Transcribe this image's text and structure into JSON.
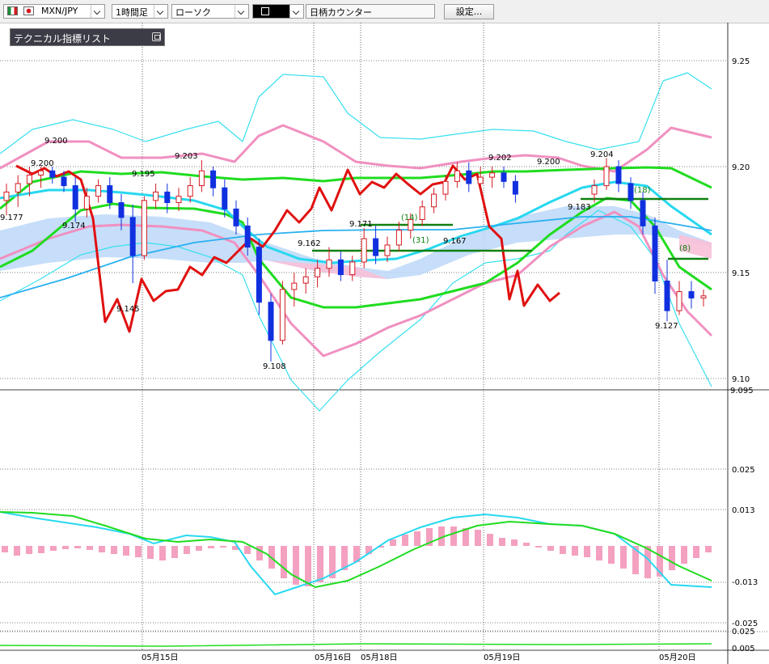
{
  "toolbar": {
    "pair_label": "MXN/JPY",
    "period_label": "1時間足",
    "chart_type_label": "ローソク",
    "counter_label": "日柄カウンター",
    "settings_label": "設定...",
    "flag_colors": [
      "#1a8f3a",
      "#ffffff",
      "#d41920"
    ],
    "jp_flag_colors": [
      "#ffffff",
      "#d41920"
    ]
  },
  "indicator_list": {
    "label": "テクニカル指標リスト"
  },
  "colors": {
    "bull_candle": "#d41920",
    "bear_candle": "#1030e0",
    "bollinger_outer": "#38e0f0",
    "bollinger_inner": "#f090c0",
    "ma_green": "#20dc20",
    "ma_cyan": "#28d8f0",
    "lagging_line": "#e01010",
    "cloud": "#bcd8f8",
    "cloud_alt": "#f8c0d8",
    "hline": "#108010",
    "long_ma": "#28b0f0",
    "macd_line": "#28d8f0",
    "macd_signal": "#20dc20",
    "macd_hist": "#f4a0c0"
  },
  "chart_data": {
    "type": "line",
    "symbol": "MXN/JPY",
    "price_axis": {
      "ticks": [
        "9.25",
        "9.20",
        "9.15",
        "9.10"
      ],
      "current_price_label": "9.095",
      "range": [
        9.095,
        9.25
      ]
    },
    "macd_axis": {
      "ticks": [
        "0.025",
        "0.013",
        "-0.013",
        "-0.025"
      ]
    },
    "sub_axis": {
      "ticks": [
        "0.025",
        "0.005"
      ]
    },
    "x_labels": [
      "05月15日",
      "05月16日",
      "05月18日",
      "05月19日",
      "05月20日"
    ],
    "price_annotations": [
      "9.177",
      "9.200",
      "9.200",
      "9.174",
      "9.195",
      "9.145",
      "9.203",
      "9.108",
      "9.162",
      "9.171",
      "9.167",
      "9.202",
      "9.200",
      "9.183",
      "9.204",
      "9.127"
    ],
    "count_annotations": [
      "(14)",
      "(31)",
      "(18)",
      "(8)"
    ],
    "candles": [
      [
        9.184,
        9.192,
        9.177,
        9.188
      ],
      [
        9.188,
        9.196,
        9.181,
        9.192
      ],
      [
        9.192,
        9.2,
        9.186,
        9.196
      ],
      [
        9.196,
        9.2,
        9.19,
        9.198
      ],
      [
        9.198,
        9.2,
        9.192,
        9.195
      ],
      [
        9.195,
        9.198,
        9.188,
        9.191
      ],
      [
        9.191,
        9.195,
        9.174,
        9.18
      ],
      [
        9.18,
        9.19,
        9.176,
        9.186
      ],
      [
        9.186,
        9.194,
        9.183,
        9.191
      ],
      [
        9.191,
        9.195,
        9.18,
        9.183
      ],
      [
        9.183,
        9.187,
        9.17,
        9.176
      ],
      [
        9.176,
        9.182,
        9.145,
        9.158
      ],
      [
        9.158,
        9.186,
        9.156,
        9.184
      ],
      [
        9.184,
        9.192,
        9.18,
        9.188
      ],
      [
        9.188,
        9.192,
        9.178,
        9.183
      ],
      [
        9.183,
        9.19,
        9.179,
        9.186
      ],
      [
        9.186,
        9.195,
        9.183,
        9.191
      ],
      [
        9.191,
        9.203,
        9.188,
        9.198
      ],
      [
        9.198,
        9.2,
        9.186,
        9.19
      ],
      [
        9.19,
        9.194,
        9.176,
        9.18
      ],
      [
        9.18,
        9.184,
        9.168,
        9.172
      ],
      [
        9.172,
        9.176,
        9.158,
        9.162
      ],
      [
        9.162,
        9.166,
        9.13,
        9.136
      ],
      [
        9.136,
        9.14,
        9.108,
        9.118
      ],
      [
        9.118,
        9.146,
        9.116,
        9.142
      ],
      [
        9.142,
        9.15,
        9.134,
        9.145
      ],
      [
        9.145,
        9.152,
        9.14,
        9.148
      ],
      [
        9.148,
        9.156,
        9.143,
        9.152
      ],
      [
        9.152,
        9.162,
        9.148,
        9.156
      ],
      [
        9.156,
        9.16,
        9.146,
        9.149
      ],
      [
        9.149,
        9.158,
        9.146,
        9.155
      ],
      [
        9.155,
        9.171,
        9.152,
        9.166
      ],
      [
        9.166,
        9.172,
        9.154,
        9.158
      ],
      [
        9.158,
        9.167,
        9.155,
        9.163
      ],
      [
        9.163,
        9.174,
        9.16,
        9.17
      ],
      [
        9.17,
        9.178,
        9.166,
        9.175
      ],
      [
        9.175,
        9.184,
        9.172,
        9.181
      ],
      [
        9.181,
        9.19,
        9.178,
        9.187
      ],
      [
        9.187,
        9.196,
        9.184,
        9.193
      ],
      [
        9.193,
        9.202,
        9.19,
        9.198
      ],
      [
        9.198,
        9.202,
        9.188,
        9.192
      ],
      [
        9.192,
        9.2,
        9.188,
        9.195
      ],
      [
        9.195,
        9.2,
        9.19,
        9.197
      ],
      [
        9.197,
        9.2,
        9.19,
        9.193
      ],
      [
        9.193,
        9.196,
        9.183,
        9.187
      ],
      [
        9.187,
        9.194,
        9.183,
        9.191
      ],
      [
        9.191,
        9.204,
        9.189,
        9.2
      ],
      [
        9.2,
        9.203,
        9.188,
        9.192
      ],
      [
        9.192,
        9.195,
        9.18,
        9.184
      ],
      [
        9.184,
        9.188,
        9.168,
        9.172
      ],
      [
        9.172,
        9.176,
        9.14,
        9.146
      ],
      [
        9.146,
        9.156,
        9.127,
        9.132
      ],
      [
        9.132,
        9.146,
        9.13,
        9.141
      ],
      [
        9.141,
        9.146,
        9.133,
        9.138
      ],
      [
        9.138,
        9.142,
        9.134,
        9.139
      ]
    ]
  }
}
